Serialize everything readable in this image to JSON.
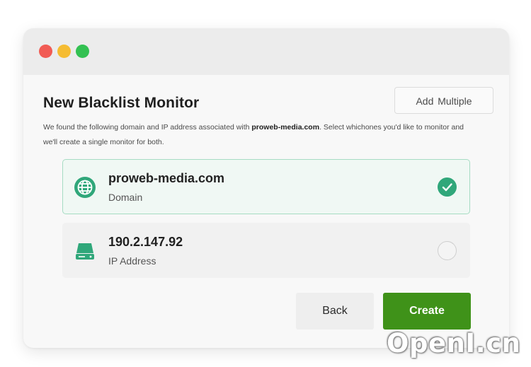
{
  "window": {
    "controls": [
      "close-icon",
      "minimize-icon",
      "maximize-icon"
    ],
    "colors": {
      "close": "#f15b54",
      "minimize": "#f5bc32",
      "maximize": "#33c152"
    }
  },
  "header": {
    "title": "New Blacklist Monitor",
    "add_multiple_label": "Add Multiple"
  },
  "description": {
    "part1": "We found the following domain and IP address associated with ",
    "domain": "proweb-media.com",
    "part2": ". Select whichones you'd like to monitor and we'll create a single monitor for both."
  },
  "options": [
    {
      "name": "proweb-media.com",
      "type": "Domain",
      "icon": "globe-icon",
      "selected": true
    },
    {
      "name": "190.2.147.92",
      "type": "IP Address",
      "icon": "server-icon",
      "selected": false
    }
  ],
  "actions": {
    "back_label": "Back",
    "create_label": "Create"
  },
  "watermark": "OpenI.cn",
  "colors": {
    "accent": "#30a77a",
    "create_button": "#3f9219",
    "selected_border": "#a6dcc3"
  }
}
